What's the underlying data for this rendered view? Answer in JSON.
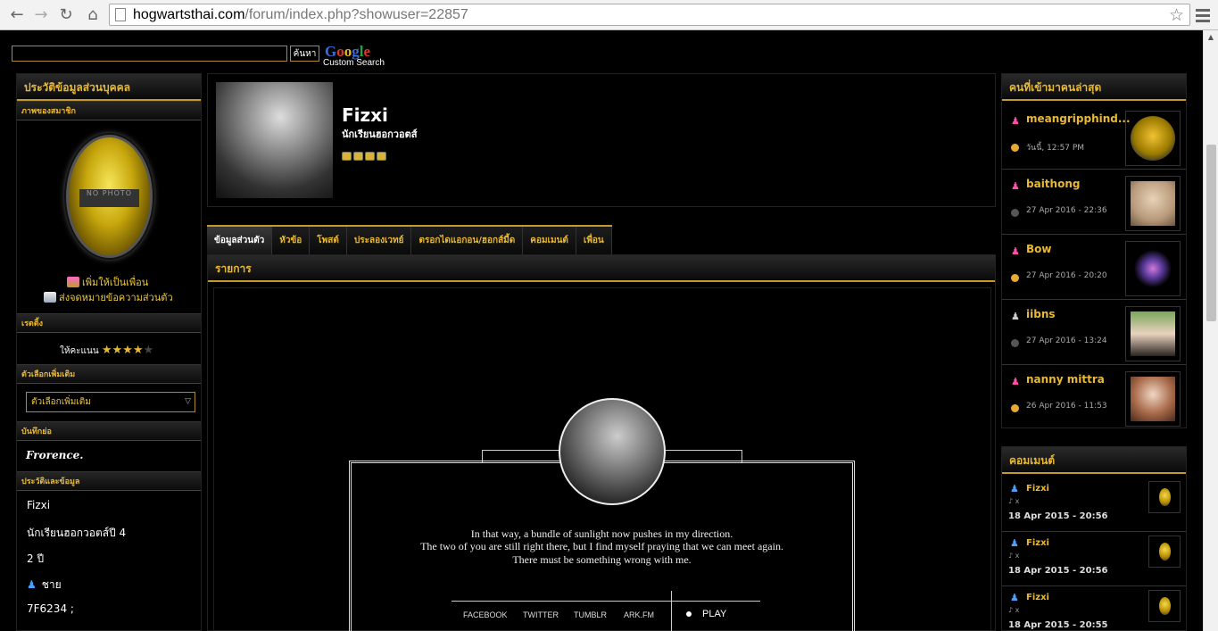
{
  "browser": {
    "url_host": "hogwartsthai.com",
    "url_path": "/forum/index.php?showuser=22857"
  },
  "search": {
    "button_label": "ค้นหา",
    "google_logo": "Google",
    "google_sub": "Custom Search"
  },
  "left": {
    "title": "ประวัติข้อมูลส่วนบุคคล",
    "photo_heading": "ภาพของสมาชิก",
    "no_photo": "NO PHOTO",
    "add_friend": "เพิ่มให้เป็นเพื่อน",
    "send_message": "ส่งจดหมายข้อความส่วนตัว",
    "rating_heading": "เรตติ้ง",
    "rating_label": "ให้คะแนน",
    "rating_value": 4,
    "options_heading": "ตัวเลือกเพิ่มเติม",
    "options_select": "ตัวเลือกเพิ่มเติม",
    "note_heading": "บันทึกย่อ",
    "note_text": "Frorence.",
    "bio_heading": "ประวัติและข้อมูล",
    "bio": [
      "Fizxi",
      "นักเรียนฮอกวอตส์ปี 4",
      "2 ปี",
      "ชาย",
      "7F6234 ;"
    ]
  },
  "profile": {
    "name": "Fizxi",
    "rank": "นักเรียนฮอกวอตส์"
  },
  "tabs": [
    "ข้อมูลส่วนตัว",
    "หัวข้อ",
    "โพสต์",
    "ประลองเวทย์",
    "ตรอกไดแอกอน/ฮอกส์มี้ด",
    "คอมเมนต์",
    "เพื่อน"
  ],
  "list": {
    "title": "รายการ",
    "quote": [
      "In that way, a bundle of sunlight now pushes in my direction.",
      "The two of you are still right there, but I find myself praying that we can meet again.",
      "There must be something wrong with me."
    ],
    "links": [
      "FACEBOOK",
      "TWITTER",
      "TUMBLR",
      "ARK.FM"
    ],
    "play": "PLAY"
  },
  "recent": {
    "title": "คนที่เข้ามาคนล่าสุด",
    "visitors": [
      {
        "name": "meangripphind...",
        "time": "วันนี้, 12:57 PM"
      },
      {
        "name": "baithong",
        "time": "27 Apr 2016 - 22:36"
      },
      {
        "name": "Bow",
        "time": "27 Apr 2016 - 20:20"
      },
      {
        "name": "iibns",
        "time": "27 Apr 2016 - 13:24"
      },
      {
        "name": "nanny mittra",
        "time": "26 Apr 2016 - 11:53"
      }
    ]
  },
  "comments": {
    "title": "คอมเมนต์",
    "items": [
      {
        "name": "Fizxi",
        "body": "♪ x",
        "date": "18 Apr 2015 - 20:56"
      },
      {
        "name": "Fizxi",
        "body": "♪ x",
        "date": "18 Apr 2015 - 20:56"
      },
      {
        "name": "Fizxi",
        "body": "♪ x",
        "date": "18 Apr 2015 - 20:55"
      }
    ]
  },
  "colors": {
    "accent_gold": "#e9b934",
    "female_icon": "#ff4fa8",
    "male_icon": "#4aa0ff"
  }
}
